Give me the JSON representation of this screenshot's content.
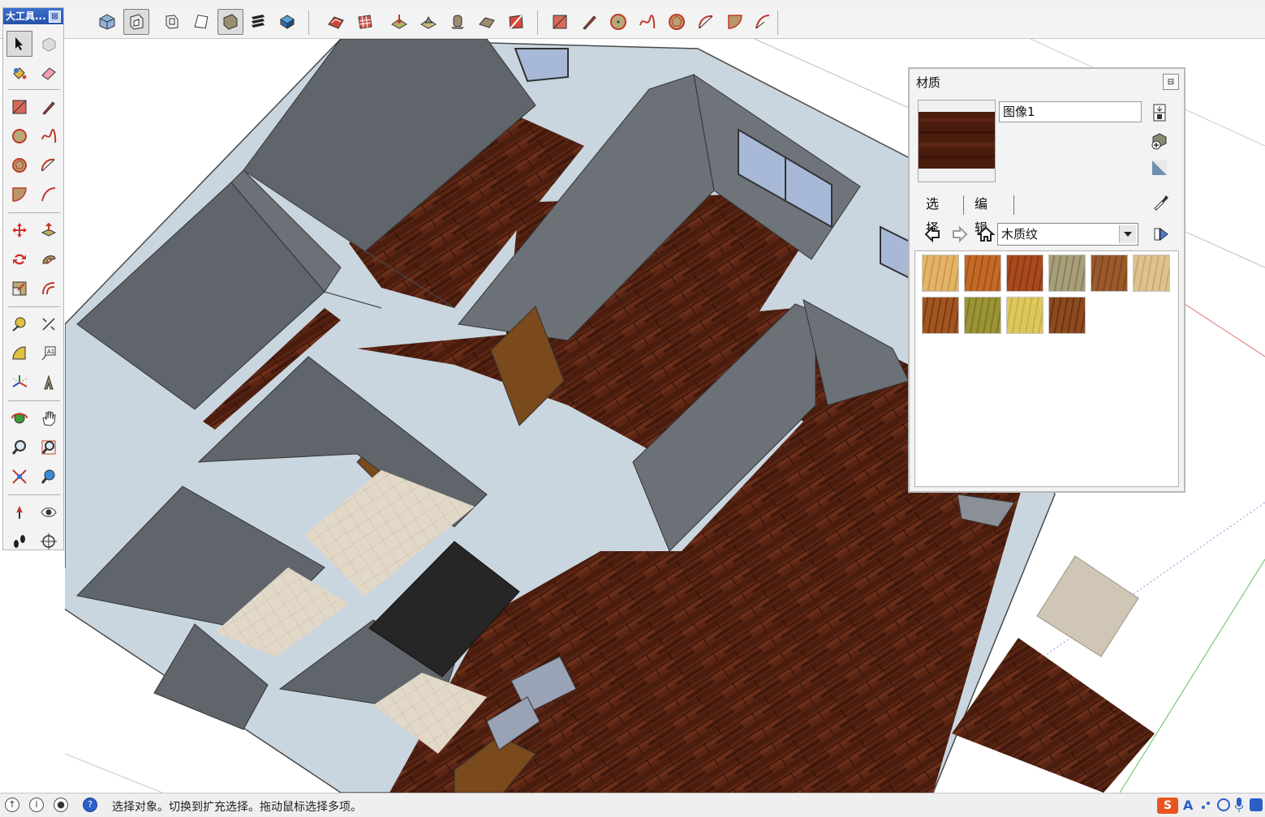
{
  "left_toolbar": {
    "title": "大工具...",
    "close_label": "⊠"
  },
  "materials": {
    "title": "材质",
    "collapse_label": "⊟",
    "material_name": "图像1",
    "tabs": [
      {
        "label": "选择"
      },
      {
        "label": "编辑"
      }
    ],
    "library": "木质纹",
    "swatches": [
      {
        "name": "wood-1",
        "color": "#e2b56a",
        "grain": "#c98f3f"
      },
      {
        "name": "wood-2",
        "color": "#c36a26",
        "grain": "#9a4a15"
      },
      {
        "name": "wood-3",
        "color": "#a84a1e",
        "grain": "#7e3210"
      },
      {
        "name": "wood-4",
        "color": "#a89f79",
        "grain": "#7d7556"
      },
      {
        "name": "wood-5",
        "color": "#9b5a2c",
        "grain": "#74401c"
      },
      {
        "name": "wood-6",
        "color": "#e0c28f",
        "grain": "#c4a06a"
      },
      {
        "name": "wood-7",
        "color": "#a35520",
        "grain": "#6e3410"
      },
      {
        "name": "wood-8",
        "color": "#9b9437",
        "grain": "#74701f"
      },
      {
        "name": "wood-9",
        "color": "#ddc860",
        "grain": "#c4aa3c"
      },
      {
        "name": "wood-10",
        "color": "#8c4a1e",
        "grain": "#5e2e0e"
      }
    ]
  },
  "status": {
    "text": "选择对象。切换到扩充选择。拖动鼠标选择多项。",
    "ime_label": "S",
    "ime_mode": "A"
  },
  "colors": {
    "floor": "#5a2514",
    "wall_top": "#c9d6e0",
    "wall_face": "#5f656b",
    "tile": "#e2d8c8",
    "door": "#7a4a1c",
    "title_blue": "#2f5fc0"
  }
}
